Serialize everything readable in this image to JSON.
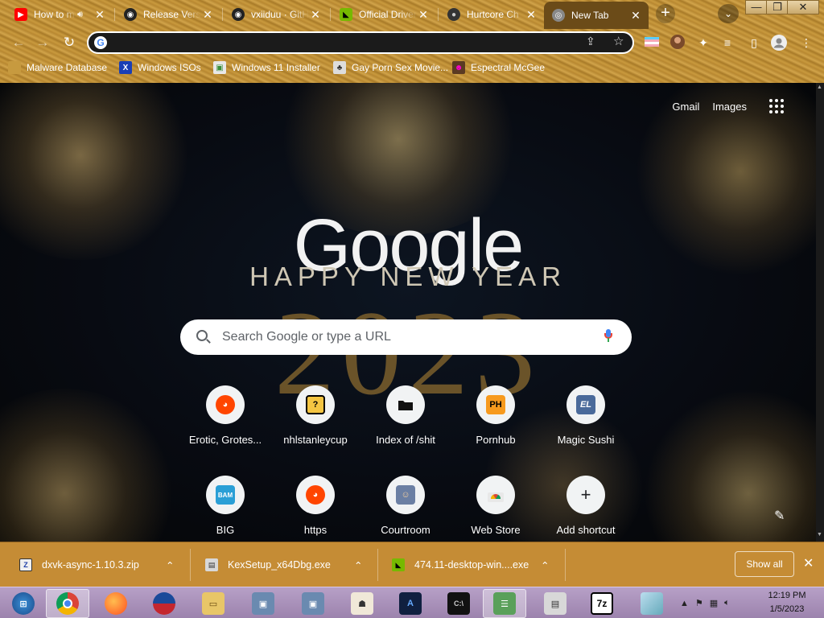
{
  "tabs": [
    {
      "title": "How to m",
      "favicon": "youtube-icon",
      "audio": "speaker-icon",
      "active": false
    },
    {
      "title": "Release Versions",
      "favicon": "github-icon",
      "active": false
    },
    {
      "title": "vxiiduu · GitHub",
      "favicon": "github-icon",
      "active": false
    },
    {
      "title": "Official Drivers",
      "favicon": "nvidia-icon",
      "active": false
    },
    {
      "title": "Hurtcore Ch",
      "favicon": "hurtcore-icon",
      "active": false
    },
    {
      "title": "New Tab",
      "favicon": "chrome-icon",
      "active": true
    }
  ],
  "toolbar": {
    "back_glyph": "←",
    "forward_glyph": "→",
    "reload_glyph": "↻",
    "omnibox_value": "",
    "new_tab_glyph": "+",
    "tab_search_glyph": "⌄"
  },
  "window_controls": {
    "minimize": "—",
    "maximize": "❐",
    "close": "✕"
  },
  "bookmarks": [
    {
      "label": "Malware Database",
      "icon": "folder-icon"
    },
    {
      "label": "Windows ISOs",
      "icon": "x-icon"
    },
    {
      "label": "Windows 11 Installer",
      "icon": "image-icon"
    },
    {
      "label": "Gay Porn Sex Movie...",
      "icon": "bookmark-site-icon"
    },
    {
      "label": "Espectral McGee",
      "icon": "face-icon"
    }
  ],
  "ntp": {
    "gmail": "Gmail",
    "images": "Images",
    "doodle_word": "Google",
    "doodle_subtitle": "HAPPY NEW YEAR",
    "doodle_year": "2023",
    "search_placeholder": "Search Google or type a URL",
    "shortcuts": [
      {
        "label": "Erotic, Grotes...",
        "icon": "reddit-icon"
      },
      {
        "label": "nhlstanleycup",
        "icon": "question-block-icon"
      },
      {
        "label": "Index of /shit",
        "icon": "folder-icon"
      },
      {
        "label": "Pornhub",
        "icon": "ph-icon",
        "text": "PH"
      },
      {
        "label": "Magic Sushi",
        "icon": "el-icon",
        "text": "EL"
      },
      {
        "label": "BIG",
        "icon": "bam-icon",
        "text": "BAM"
      },
      {
        "label": "https",
        "icon": "reddit-icon"
      },
      {
        "label": "Courtroom",
        "icon": "portrait-icon"
      },
      {
        "label": "Web Store",
        "icon": "webstore-icon"
      },
      {
        "label": "Add shortcut",
        "icon": "plus-icon",
        "text": "+"
      }
    ]
  },
  "downloads": [
    {
      "name": "dxvk-async-1.10.3.zip",
      "icon": "zip-icon"
    },
    {
      "name": "KexSetup_x64Dbg.exe",
      "icon": "exe-icon"
    },
    {
      "name": "474.11-desktop-win....exe",
      "icon": "nvidia-icon"
    }
  ],
  "shelf": {
    "show_all": "Show all",
    "close": "✕"
  },
  "clock": {
    "time": "12:19 PM",
    "date": "1/5/2023"
  },
  "colors": {
    "frame": "#b98b35",
    "shelf": "#c58c35",
    "taskbar": "#a991ba",
    "accent": "#4285f4"
  }
}
